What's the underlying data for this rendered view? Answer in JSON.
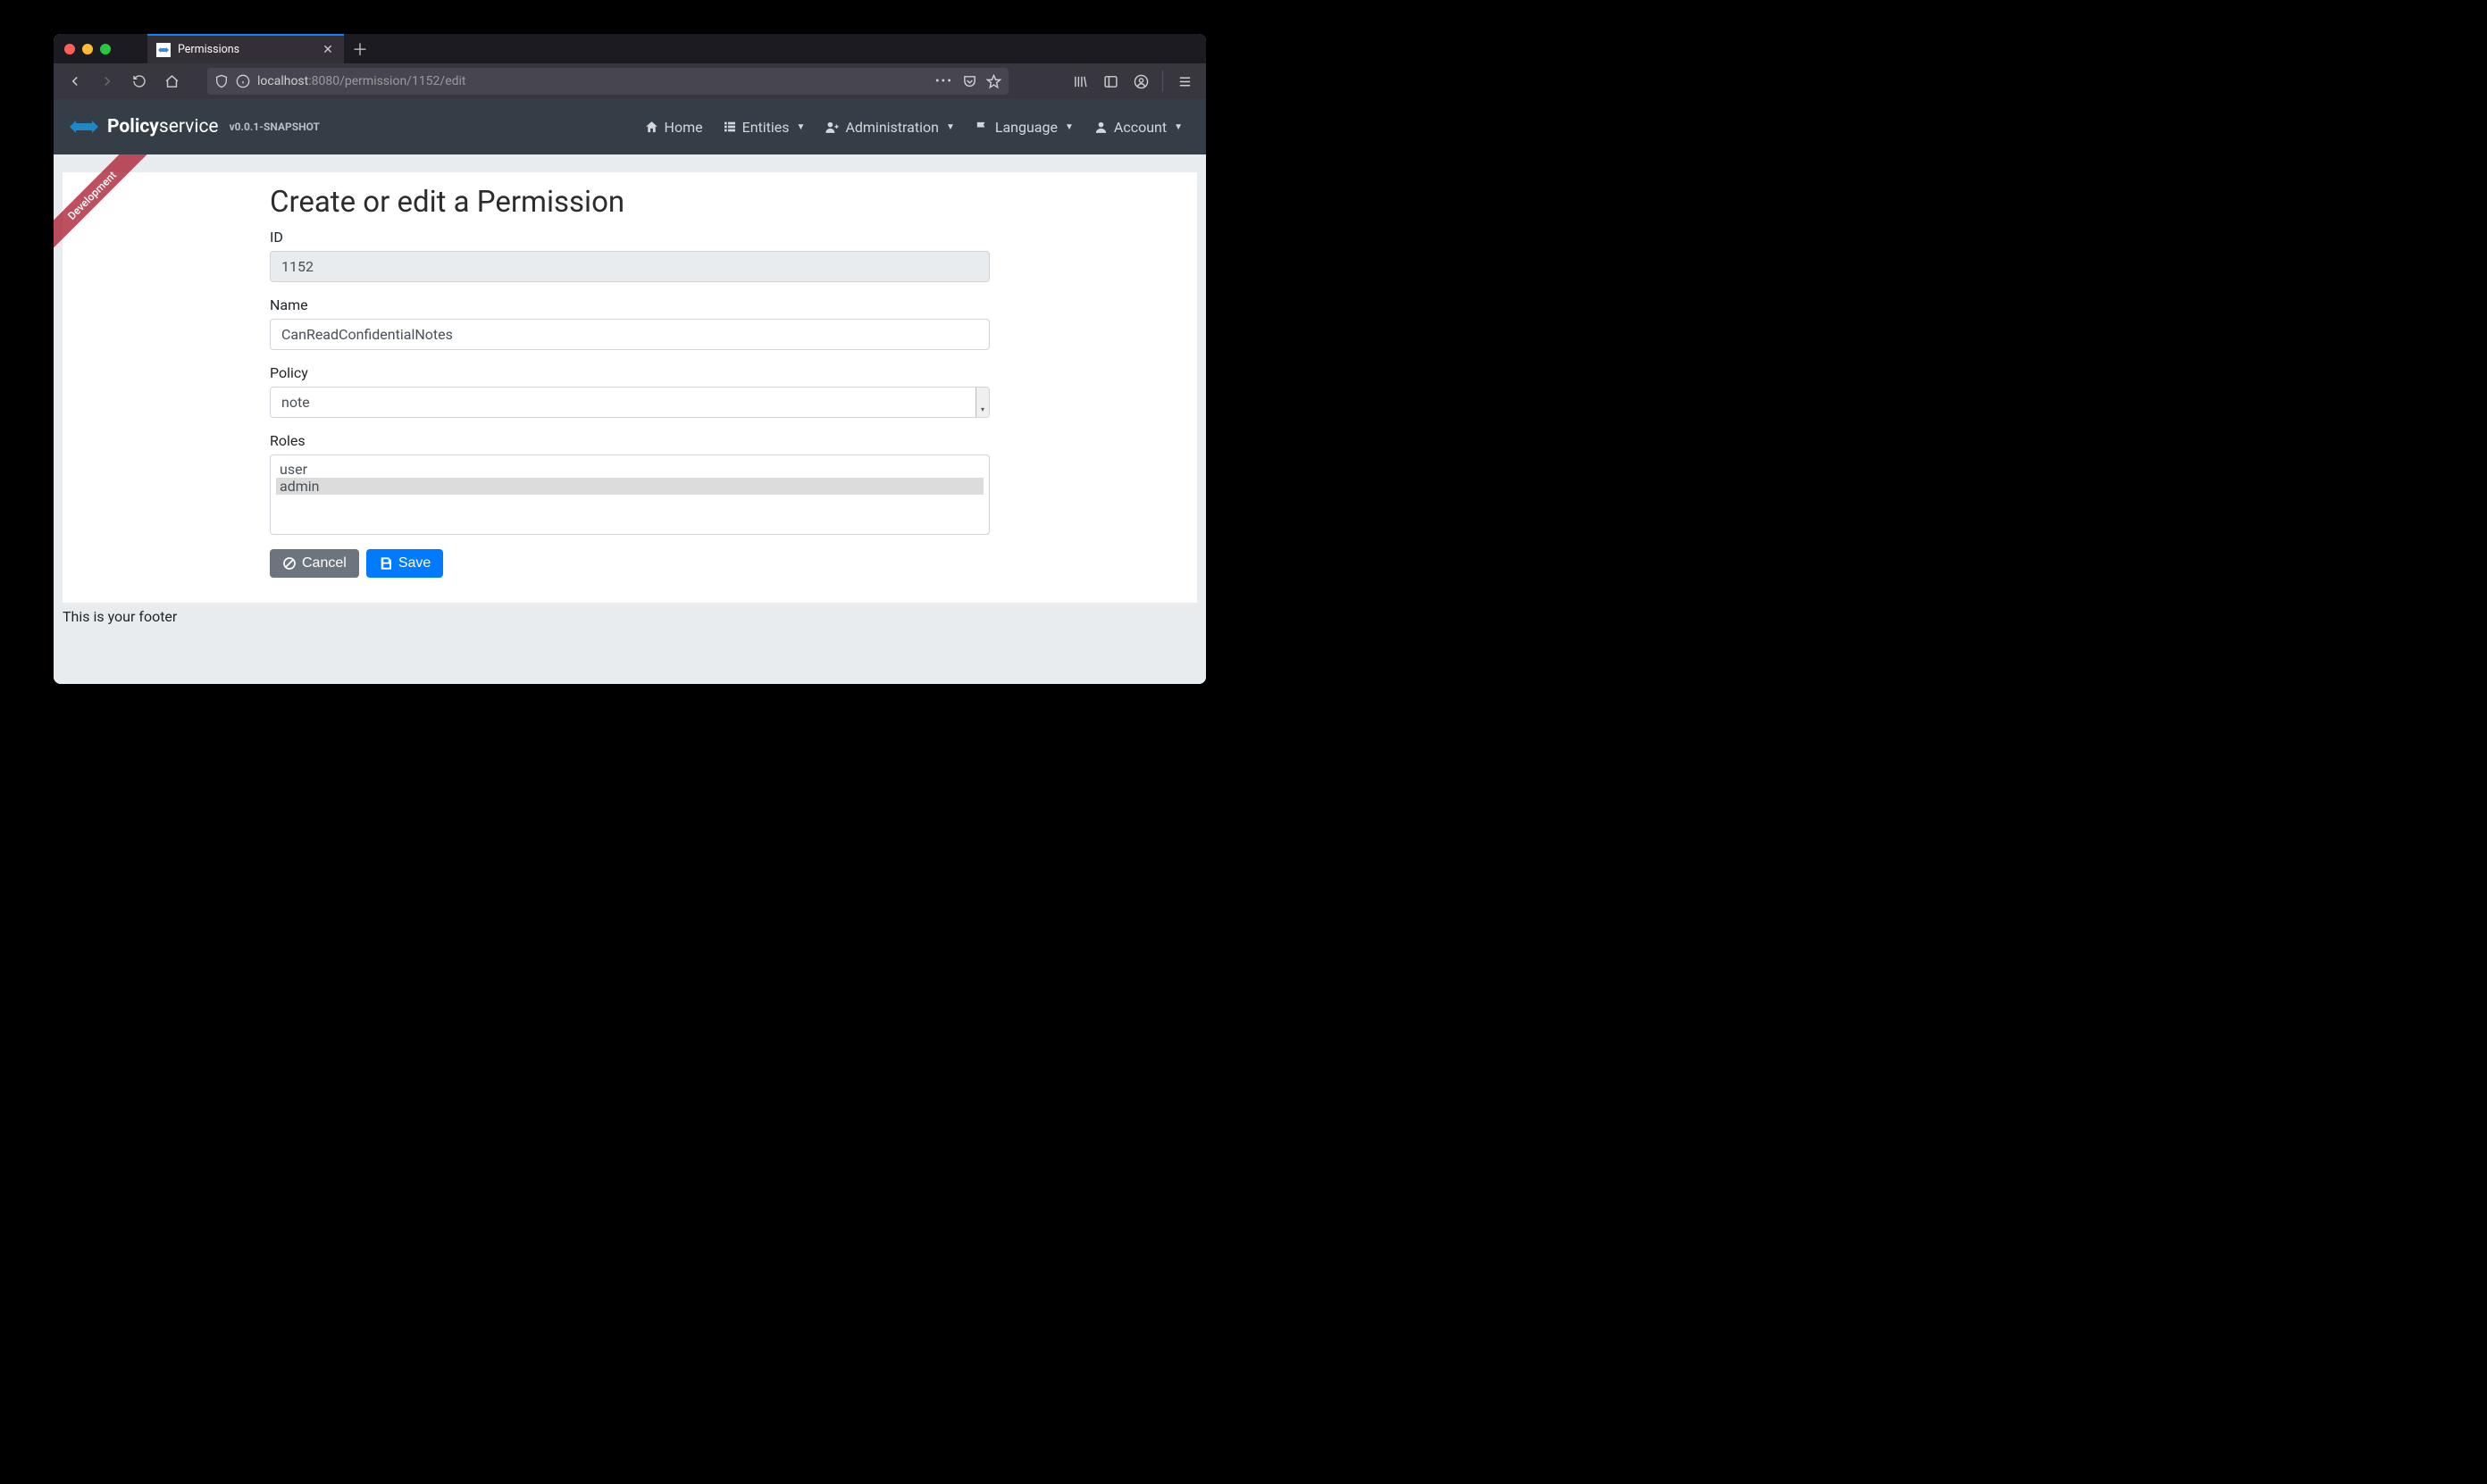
{
  "browser": {
    "tab_title": "Permissions",
    "url_host": "localhost",
    "url_port_path": ":8080/permission/1152/edit"
  },
  "ribbon": "Development",
  "brand": {
    "name1": "Policy",
    "name2": "service",
    "version": "v0.0.1-SNAPSHOT"
  },
  "nav": {
    "home": "Home",
    "entities": "Entities",
    "admin": "Administration",
    "language": "Language",
    "account": "Account"
  },
  "page": {
    "title": "Create or edit a Permission",
    "labels": {
      "id": "ID",
      "name": "Name",
      "policy": "Policy",
      "roles": "Roles"
    },
    "values": {
      "id": "1152",
      "name": "CanReadConfidentialNotes",
      "policy": "note"
    },
    "roles": [
      {
        "label": "user",
        "selected": false
      },
      {
        "label": "admin",
        "selected": true
      }
    ],
    "buttons": {
      "cancel": "Cancel",
      "save": "Save"
    }
  },
  "footer": "This is your footer"
}
